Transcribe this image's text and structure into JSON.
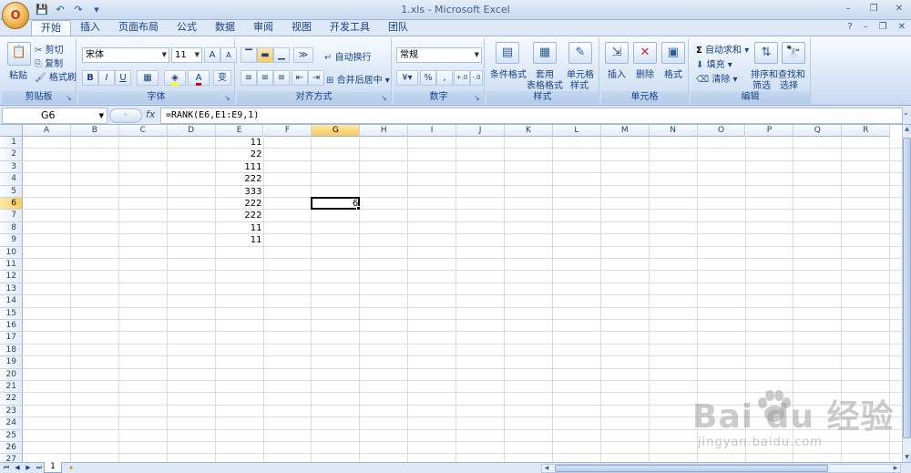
{
  "window": {
    "title": "1.xls - Microsoft Excel",
    "office_button": "O",
    "qat_save": "💾",
    "qat_undo": "↶",
    "qat_redo": "↷",
    "qat_more": "▾",
    "minimize": "–",
    "restore": "❐",
    "close": "✕"
  },
  "tabs": [
    "开始",
    "插入",
    "页面布局",
    "公式",
    "数据",
    "审阅",
    "视图",
    "开发工具",
    "团队"
  ],
  "active_tab": "开始",
  "ribbon": {
    "clipboard": {
      "label": "剪贴板",
      "paste": "粘贴",
      "cut": "剪切",
      "copy": "复制",
      "format_painter": "格式刷"
    },
    "font": {
      "label": "字体",
      "font_name": "宋体",
      "font_size": "11",
      "grow": "A",
      "shrink": "A",
      "bold": "B",
      "italic": "I",
      "underline": "U",
      "wen": "变"
    },
    "alignment": {
      "label": "对齐方式",
      "wrap_text": "自动换行",
      "merge_center": "合并后居中"
    },
    "number": {
      "label": "数字",
      "format": "常规",
      "percent": "%",
      "comma": ",",
      "inc_decimal": "+.0",
      "dec_decimal": "-.0"
    },
    "styles": {
      "label": "样式",
      "conditional": "条件格式",
      "table_format_1": "套用",
      "table_format_2": "表格格式",
      "cell_styles_1": "单元格",
      "cell_styles_2": "样式"
    },
    "cells": {
      "label": "单元格",
      "insert": "插入",
      "delete": "删除",
      "format": "格式"
    },
    "editing": {
      "label": "编辑",
      "autosum": "自动求和",
      "fill": "填充",
      "clear": "清除",
      "sort_filter_1": "排序和",
      "sort_filter_2": "筛选",
      "find_select_1": "查找和",
      "find_select_2": "选择"
    }
  },
  "formula_bar": {
    "name_box": "G6",
    "fx": "fx",
    "formula": "=RANK(E6,E1:E9,1)"
  },
  "columns": [
    "A",
    "B",
    "C",
    "D",
    "E",
    "F",
    "G",
    "H",
    "I",
    "J",
    "K",
    "L",
    "M",
    "N",
    "O",
    "P",
    "Q",
    "R"
  ],
  "selected_column": "G",
  "rows": [
    "1",
    "2",
    "3",
    "4",
    "5",
    "6",
    "7",
    "8",
    "9",
    "10",
    "11",
    "12",
    "13",
    "14",
    "15",
    "16",
    "17",
    "18",
    "19",
    "20",
    "21",
    "22",
    "23",
    "24",
    "25",
    "26",
    "27"
  ],
  "selected_row": "6",
  "cells": {
    "E1": "11",
    "E2": "22",
    "E3": "111",
    "E4": "222",
    "E5": "333",
    "E6": "222",
    "E7": "222",
    "E8": "11",
    "E9": "11",
    "G6": "6"
  },
  "sheets": [
    "1"
  ],
  "watermark": {
    "main": "Bai  du 经验",
    "sub": "jingyan.baidu.com"
  }
}
